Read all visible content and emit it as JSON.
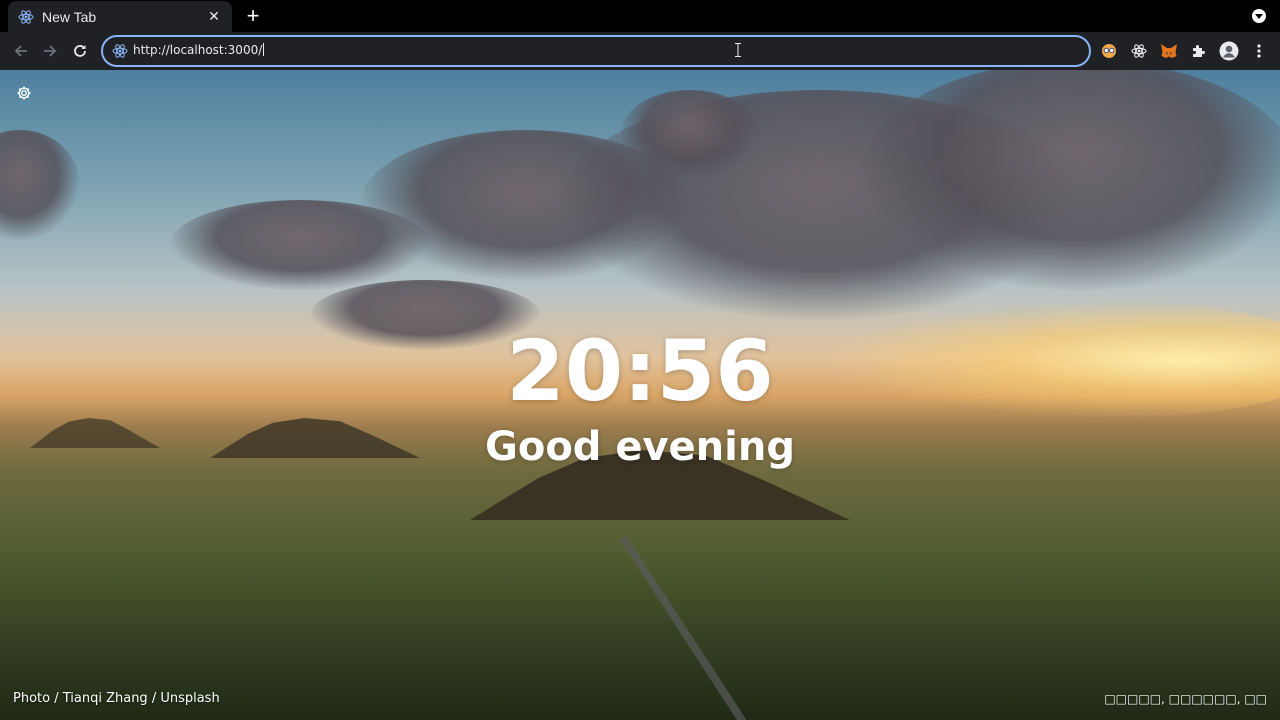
{
  "browser": {
    "tab": {
      "title": "New Tab",
      "close_glyph": "✕",
      "favicon": "react-icon"
    },
    "new_tab_glyph": "+",
    "address_bar": {
      "url": "http://localhost:3000/",
      "site_icon": "react-icon"
    },
    "extensions": [
      "glasses-extension-icon",
      "react-devtools-icon",
      "metamask-fox-icon",
      "puzzle-extensions-icon",
      "profile-avatar-icon",
      "kebab-menu-icon"
    ],
    "accent_color": "#8ab4f8"
  },
  "newtab_page": {
    "time": "20:56",
    "greeting": "Good evening",
    "photo_credit": "Photo / Tianqi Zhang / Unsplash",
    "photo_location": "□□□□□, □□□□□□, □□"
  }
}
